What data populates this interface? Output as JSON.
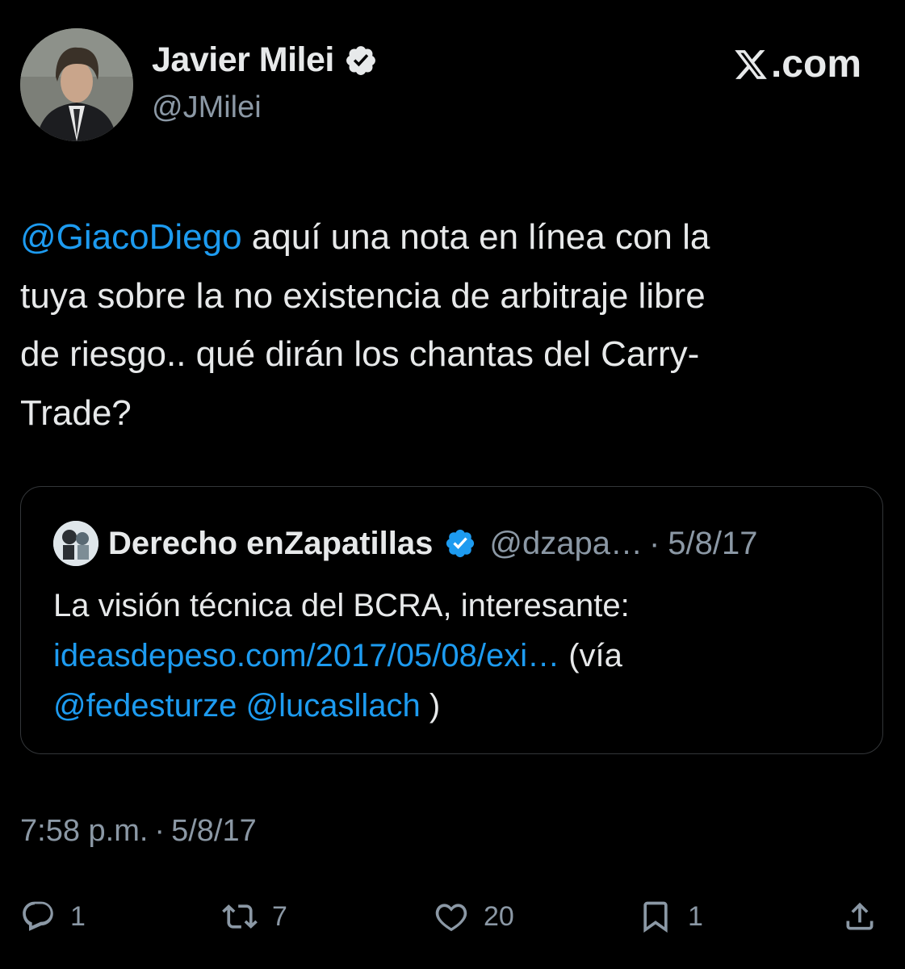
{
  "author": {
    "display_name": "Javier Milei",
    "handle": "@JMilei",
    "verified": true
  },
  "brand": {
    "label": ".com"
  },
  "tweet": {
    "lines": [
      {
        "mention": "@GiacoDiego",
        "text": " aquí una nota en línea con la"
      },
      {
        "text": "tuya sobre la no existencia de arbitraje libre"
      },
      {
        "text": "de riesgo.. qué dirán los chantas del Carry-"
      },
      {
        "text": "Trade?"
      }
    ]
  },
  "quoted_tweet": {
    "display_name": "Derecho enZapatillas",
    "handle": "@dzapa…",
    "separator": "·",
    "date": "5/8/17",
    "body": {
      "line1": "La visión técnica del BCRA, interesante:",
      "link": "ideasdepeso.com/2017/05/08/exi…",
      "after_link": " (vía",
      "mention1": "@fedesturze",
      "mention2": "@lucasllach",
      "closing": " )"
    }
  },
  "timestamp": {
    "time": "7:58 p.m.",
    "separator": "·",
    "date": "5/8/17"
  },
  "actions": {
    "replies": "1",
    "reposts": "7",
    "likes": "20",
    "bookmarks": "1"
  },
  "colors": {
    "background": "#000000",
    "text": "#e7e9ea",
    "secondary": "#8b98a5",
    "accent": "#1d9bf0",
    "border": "#333639"
  }
}
